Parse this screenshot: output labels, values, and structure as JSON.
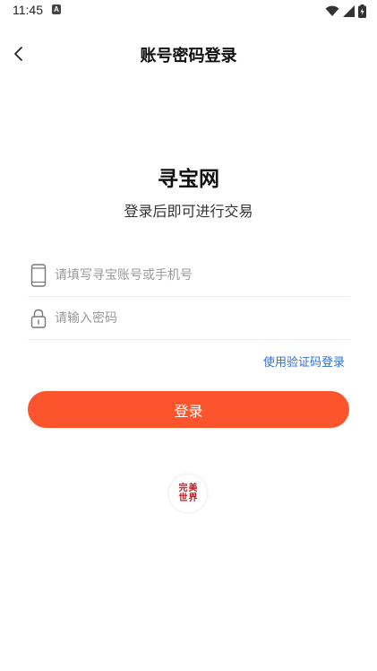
{
  "status_bar": {
    "time": "11:45",
    "notification_icon": "A"
  },
  "header": {
    "title": "账号密码登录",
    "back_icon": "chevron-left-icon"
  },
  "brand": {
    "title": "寻宝网",
    "subtitle": "登录后即可进行交易"
  },
  "form": {
    "account_placeholder": "请填写寻宝账号或手机号",
    "account_value": "",
    "password_placeholder": "请输入密码",
    "password_value": "",
    "sms_login_link": "使用验证码登录",
    "submit_label": "登录"
  },
  "third_party": {
    "logo_text": [
      "完",
      "美",
      "世",
      "界"
    ]
  },
  "colors": {
    "accent": "#fc542c",
    "link": "#2f6fd8",
    "logo": "#c8161d"
  }
}
